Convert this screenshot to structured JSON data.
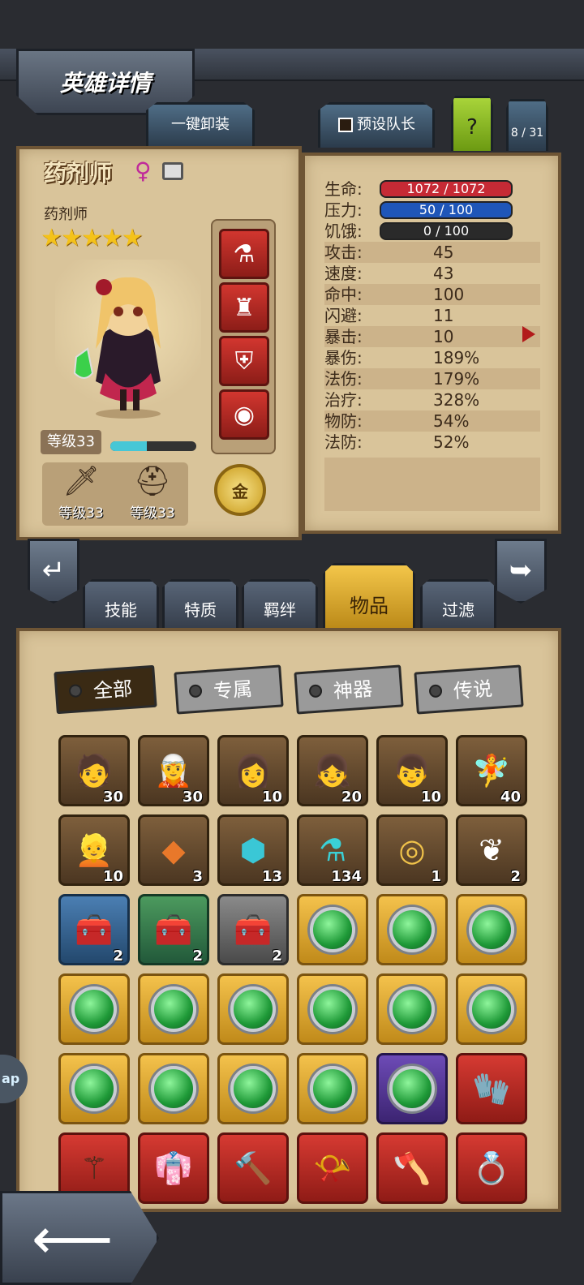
{
  "header": {
    "title": "英雄详情"
  },
  "top_buttons": {
    "unequip_all": "一键卸装",
    "preset_leader": "预设队长",
    "help": "?",
    "hero_counter": "8 / 31"
  },
  "hero": {
    "name": "药剂师",
    "gender_symbol": "♀",
    "class_name": "药剂师",
    "stars": "★★★★★",
    "level_label": "等级33",
    "xp_progress": 0.42,
    "weapon_level": "等级33",
    "armor_level": "等级33",
    "gold_button": "金"
  },
  "stats": {
    "life": {
      "label": "生命:",
      "value": "1072 / 1072"
    },
    "stress": {
      "label": "压力:",
      "value": "50 / 100"
    },
    "hunger": {
      "label": "饥饿:",
      "value": "0 / 100"
    },
    "rows": [
      {
        "label": "攻击:",
        "value": "45"
      },
      {
        "label": "速度:",
        "value": "43"
      },
      {
        "label": "命中:",
        "value": "100"
      },
      {
        "label": "闪避:",
        "value": "11"
      },
      {
        "label": "暴击:",
        "value": "10"
      },
      {
        "label": "暴伤:",
        "value": "189%"
      },
      {
        "label": "法伤:",
        "value": "179%"
      },
      {
        "label": "治疗:",
        "value": "328%"
      },
      {
        "label": "物防:",
        "value": "54%"
      },
      {
        "label": "法防:",
        "value": "52%"
      }
    ]
  },
  "category_tabs": [
    "技能",
    "特质",
    "羁绊",
    "物品",
    "过滤"
  ],
  "active_tab": "物品",
  "filters": [
    "全部",
    "专属",
    "神器",
    "传说"
  ],
  "inventory_counts": {
    "row1": [
      "30",
      "30",
      "10",
      "20",
      "10",
      "40"
    ],
    "row2": [
      "10",
      "3",
      "13",
      "134",
      "1",
      "2"
    ],
    "row3": [
      "2",
      "2",
      "2"
    ]
  },
  "icons": {
    "edit": "edit-icon",
    "back": "back-arrow-icon",
    "prev": "prev-hero-icon",
    "next": "next-hero-icon",
    "weapon": "sword-icon",
    "armor": "helmet-icon"
  },
  "edge_tag": "ap"
}
